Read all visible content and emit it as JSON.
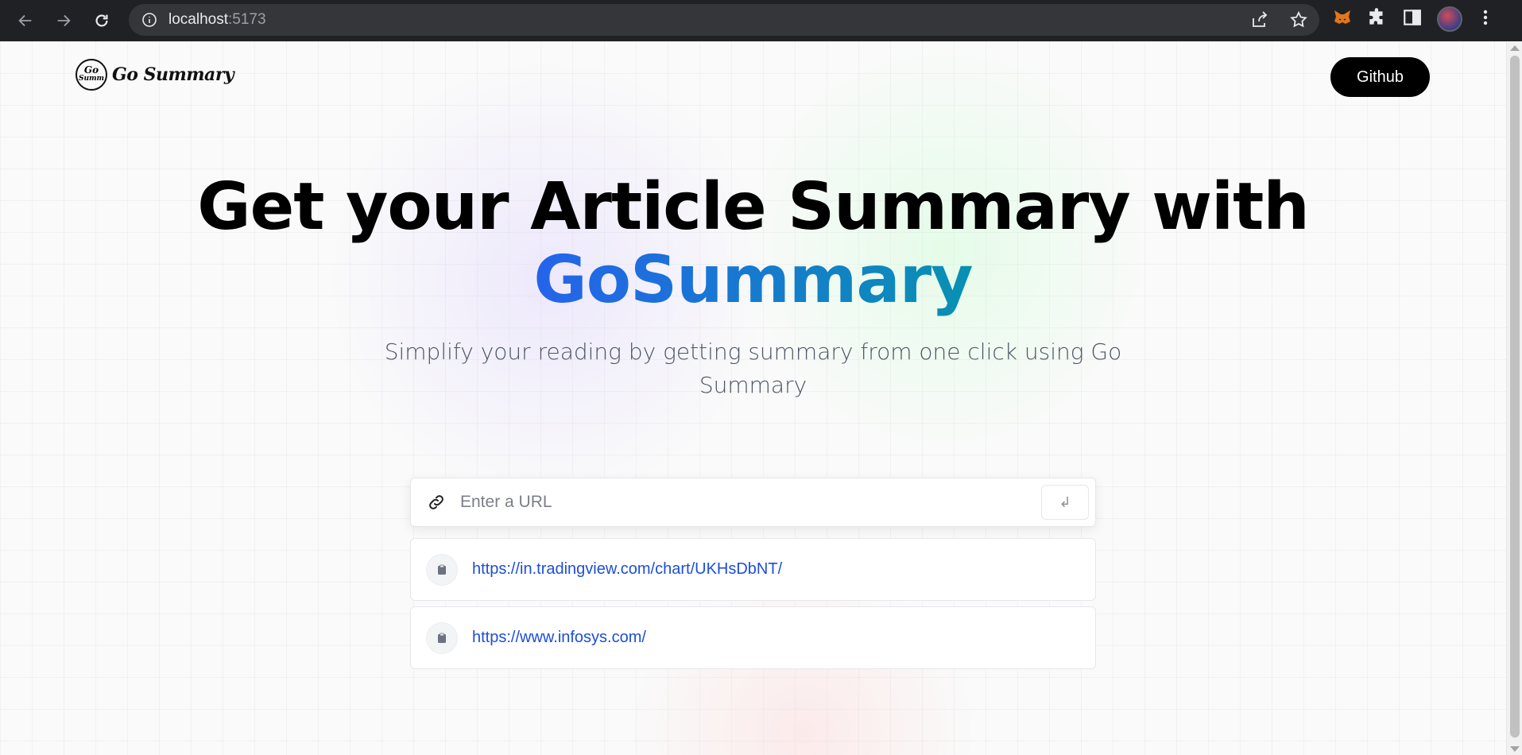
{
  "browser": {
    "url_host": "localhost",
    "url_port": ":5173",
    "icons": [
      "back-arrow-icon",
      "forward-arrow-icon",
      "reload-icon",
      "site-info-icon",
      "share-icon",
      "bookmark-star-icon",
      "metamask-fox-icon",
      "extensions-puzzle-icon",
      "side-panel-icon",
      "profile-avatar",
      "kebab-menu-icon"
    ]
  },
  "nav": {
    "logo_badge_line1": "Go",
    "logo_badge_line2": "Summ",
    "logo_text": "Go Summary",
    "github_label": "Github"
  },
  "hero": {
    "title_line1": "Get your Article Summary with",
    "title_line2": "GoSummary",
    "subtitle": "Simplify your reading by getting summary from one click using Go Summary",
    "gradient_colors": [
      "#2563eb",
      "#0891b2"
    ]
  },
  "form": {
    "placeholder": "Enter a URL",
    "value": "",
    "submit_glyph": "↲"
  },
  "history": [
    {
      "url": "https://in.tradingview.com/chart/UKHsDbNT/"
    },
    {
      "url": "https://www.infosys.com/"
    }
  ]
}
